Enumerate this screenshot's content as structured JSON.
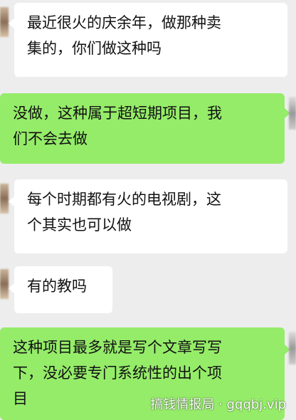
{
  "chat": {
    "messages": [
      {
        "side": "in",
        "lines": [
          "最近很火的庆余年，做那种卖",
          "集的，你们做这种吗"
        ]
      },
      {
        "side": "out",
        "lines": [
          "没做，这种属于超短期项目，我",
          "们不会去做"
        ]
      },
      {
        "side": "in",
        "lines": [
          "每个时期都有火的电视剧，这",
          "个其实也可以做"
        ]
      },
      {
        "side": "in",
        "lines": [
          "有的教吗"
        ]
      },
      {
        "side": "out",
        "lines": [
          "这种项目最多就是写个文章写写",
          "下，没必要专门系统性的出个项",
          "目"
        ]
      }
    ]
  },
  "watermark": {
    "text": "搞钱情报局 · gqqbj.vip"
  },
  "colors": {
    "background": "#ededed",
    "incoming_bubble": "#ffffff",
    "outgoing_bubble": "#95ec69"
  }
}
